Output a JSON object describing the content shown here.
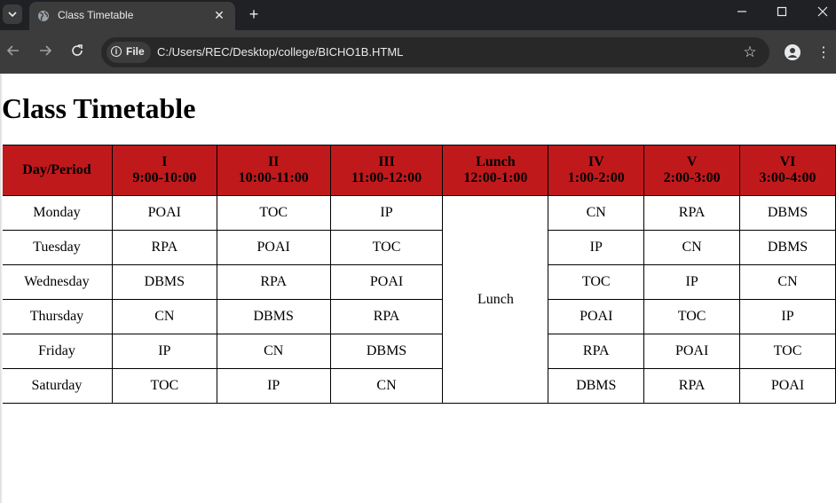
{
  "browser": {
    "tab_title": "Class Timetable",
    "close_tab": "✕",
    "new_tab": "+",
    "chip_label": "File",
    "url": "C:/Users/REC/Desktop/college/BICHO1B.HTML"
  },
  "page": {
    "heading": "Class Timetable"
  },
  "timetable": {
    "header_bg": "#c0191c",
    "headers": [
      {
        "line1": "Day/Period",
        "line2": ""
      },
      {
        "line1": "I",
        "line2": "9:00-10:00"
      },
      {
        "line1": "II",
        "line2": "10:00-11:00"
      },
      {
        "line1": "III",
        "line2": "11:00-12:00"
      },
      {
        "line1": "Lunch",
        "line2": "12:00-1:00"
      },
      {
        "line1": "IV",
        "line2": "1:00-2:00"
      },
      {
        "line1": "V",
        "line2": "2:00-3:00"
      },
      {
        "line1": "VI",
        "line2": "3:00-4:00"
      }
    ],
    "lunch_label": "Lunch",
    "rows": [
      {
        "day": "Monday",
        "p1": "POAI",
        "p2": "TOC",
        "p3": "IP",
        "p4": "CN",
        "p5": "RPA",
        "p6": "DBMS"
      },
      {
        "day": "Tuesday",
        "p1": "RPA",
        "p2": "POAI",
        "p3": "TOC",
        "p4": "IP",
        "p5": "CN",
        "p6": "DBMS"
      },
      {
        "day": "Wednesday",
        "p1": "DBMS",
        "p2": "RPA",
        "p3": "POAI",
        "p4": "TOC",
        "p5": "IP",
        "p6": "CN"
      },
      {
        "day": "Thursday",
        "p1": "CN",
        "p2": "DBMS",
        "p3": "RPA",
        "p4": "POAI",
        "p5": "TOC",
        "p6": "IP"
      },
      {
        "day": "Friday",
        "p1": "IP",
        "p2": "CN",
        "p3": "DBMS",
        "p4": "RPA",
        "p5": "POAI",
        "p6": "TOC"
      },
      {
        "day": "Saturday",
        "p1": "TOC",
        "p2": "IP",
        "p3": "CN",
        "p4": "DBMS",
        "p5": "RPA",
        "p6": "POAI"
      }
    ]
  }
}
